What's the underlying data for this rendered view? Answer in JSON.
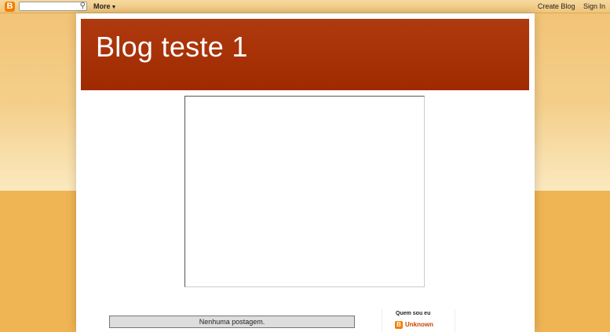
{
  "navbar": {
    "logo_glyph": "B",
    "search_placeholder": "",
    "more_label": "More",
    "create_blog_label": "Create Blog",
    "sign_in_label": "Sign In"
  },
  "header": {
    "blog_title": "Blog teste 1"
  },
  "main": {
    "no_posts_text": "Nenhuma postagem."
  },
  "sidebar": {
    "about_title": "Quem sou eu",
    "profile_name": "Unknown",
    "profile_icon_glyph": "B"
  },
  "colors": {
    "header_bg": "#a82f08",
    "blogger_orange": "#f57d00",
    "page_bg": "#f0b656",
    "link_color": "#cc4400"
  }
}
